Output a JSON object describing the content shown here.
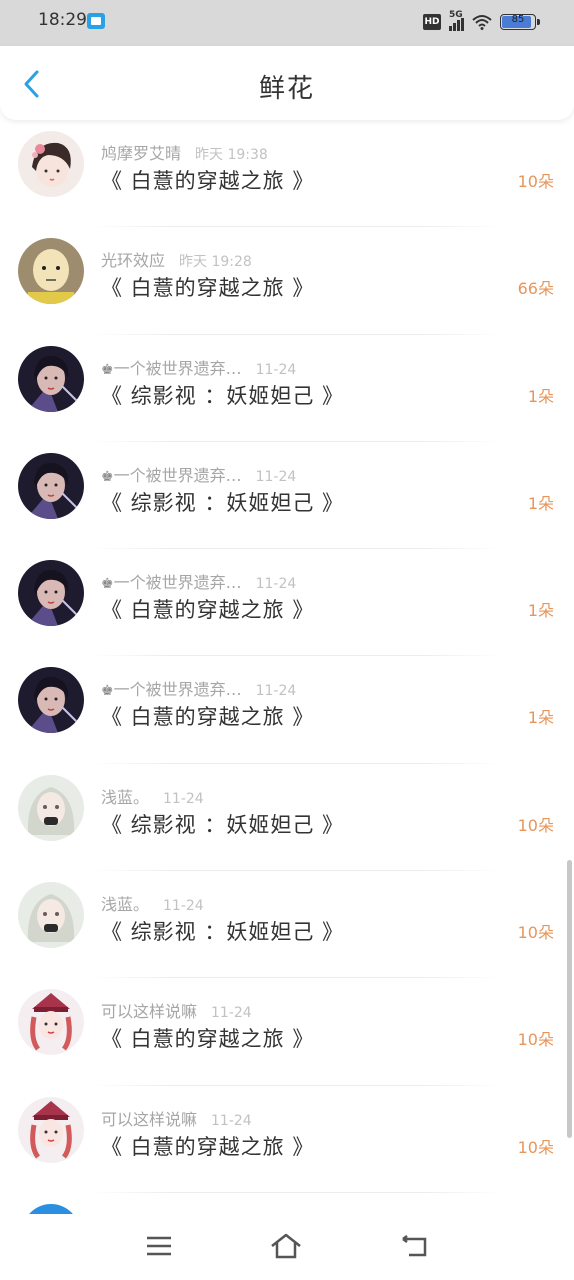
{
  "status_bar": {
    "time": "18:29",
    "network": "5G",
    "hd": "HD",
    "battery": "85"
  },
  "header": {
    "title": "鲜花"
  },
  "colors": {
    "accent": "#2aa0e6",
    "amount": "#e8955a"
  },
  "rows": [
    {
      "user": "鸠摩罗艾晴",
      "crown": "",
      "time": "昨天 19:38",
      "book": "《 白薏的穿越之旅 》",
      "amount": "10朵",
      "avatar": "woman-flowers"
    },
    {
      "user": "光环效应",
      "crown": "",
      "time": "昨天 19:28",
      "book": "《 白薏的穿越之旅 》",
      "amount": "66朵",
      "avatar": "bald-man"
    },
    {
      "user": "一个被世界遗弃…",
      "crown": "♚",
      "time": "11-24",
      "book": "《 综影视 ：妖姬妲己 》",
      "amount": "1朵",
      "avatar": "dark-boy"
    },
    {
      "user": "一个被世界遗弃…",
      "crown": "♚",
      "time": "11-24",
      "book": "《 综影视 ：妖姬妲己 》",
      "amount": "1朵",
      "avatar": "dark-boy"
    },
    {
      "user": "一个被世界遗弃…",
      "crown": "♚",
      "time": "11-24",
      "book": "《 白薏的穿越之旅 》",
      "amount": "1朵",
      "avatar": "dark-boy"
    },
    {
      "user": "一个被世界遗弃…",
      "crown": "♚",
      "time": "11-24",
      "book": "《 白薏的穿越之旅 》",
      "amount": "1朵",
      "avatar": "dark-boy"
    },
    {
      "user": "浅蓝。",
      "crown": "",
      "time": "11-24",
      "book": "《 综影视 ：妖姬妲己 》",
      "amount": "10朵",
      "avatar": "silver-girl"
    },
    {
      "user": "浅蓝。",
      "crown": "",
      "time": "11-24",
      "book": "《 综影视 ：妖姬妲己 》",
      "amount": "10朵",
      "avatar": "silver-girl"
    },
    {
      "user": "可以这样说嘛",
      "crown": "",
      "time": "11-24",
      "book": "《 白薏的穿越之旅 》",
      "amount": "10朵",
      "avatar": "red-hat-girl"
    },
    {
      "user": "可以这样说嘛",
      "crown": "",
      "time": "11-24",
      "book": "《 白薏的穿越之旅 》",
      "amount": "10朵",
      "avatar": "red-hat-girl"
    }
  ],
  "nav": {
    "menu_icon": "menu-icon",
    "home_icon": "home-icon",
    "back_icon": "return-icon"
  }
}
